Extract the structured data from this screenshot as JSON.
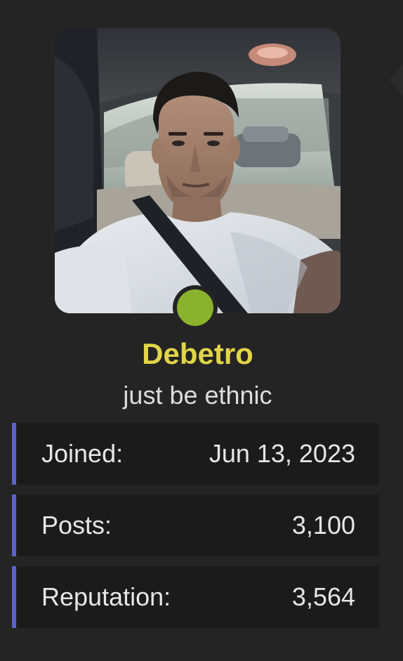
{
  "profile": {
    "username": "Debetro",
    "user_title": "just be ethnic",
    "online": true
  },
  "stats": [
    {
      "label": "Joined:",
      "value": "Jun 13, 2023"
    },
    {
      "label": "Posts:",
      "value": "3,100"
    },
    {
      "label": "Reputation:",
      "value": "3,564"
    }
  ],
  "colors": {
    "background": "#242424",
    "username": "#e1d447",
    "online_indicator": "#8ab22c",
    "stat_accent": "#5a63c7",
    "stat_background": "#1b1b1b"
  }
}
